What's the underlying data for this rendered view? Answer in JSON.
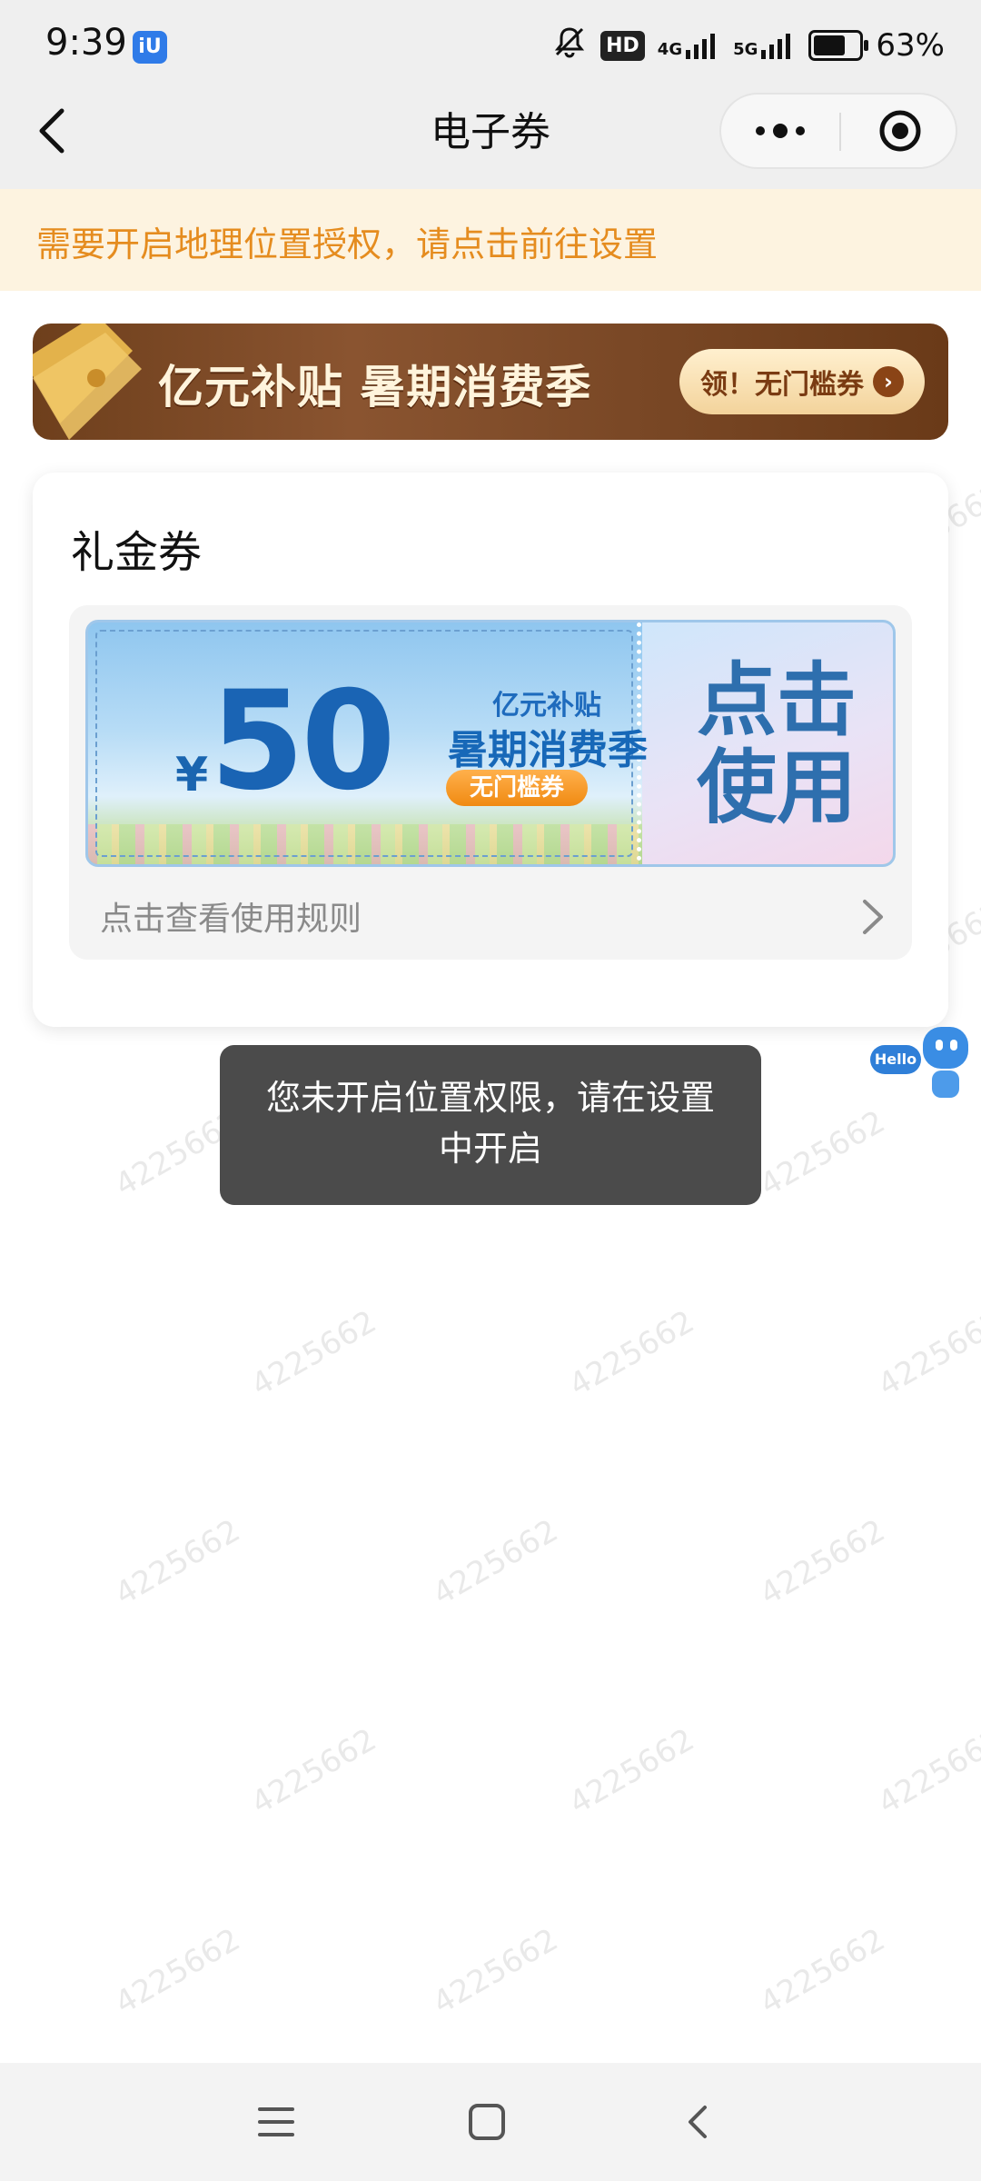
{
  "status_bar": {
    "time": "9:39",
    "app_badge": "iU",
    "hd_label": "HD",
    "net1": "4G",
    "net2": "5G",
    "battery": "63%",
    "battery_level": 0.63
  },
  "header": {
    "title": "电子券",
    "back_icon": "chevron-left-icon",
    "more_icon": "more-dots-icon",
    "close_icon": "target-close-icon"
  },
  "location_notice": {
    "text": "需要开启地理位置授权，请点击前往设置"
  },
  "banner": {
    "title": "亿元补贴 暑期消费季",
    "button_label": "领！无门槛券",
    "button_icon": "arrow-right-icon"
  },
  "coupon_section": {
    "title": "礼金券",
    "coupon": {
      "currency": "¥",
      "amount": "50",
      "sub_title_1": "亿元补贴",
      "sub_title_2": "暑期消费季",
      "tag": "无门槛券",
      "action": "点击使用"
    },
    "rules_link": "点击查看使用规则"
  },
  "floating_bot": {
    "label": "Hello"
  },
  "toast": {
    "message": "您未开启位置权限，请在设置中开启"
  },
  "watermark": "4225662",
  "bottom_nav": {
    "menu_icon": "menu-icon",
    "home_icon": "home-square-icon",
    "back_icon": "back-triangle-icon"
  },
  "colors": {
    "notice_text": "#e58c1f",
    "notice_bg": "#fdf3e0",
    "coupon_blue": "#1a64b4",
    "toast_bg": "#4b4b4b"
  }
}
